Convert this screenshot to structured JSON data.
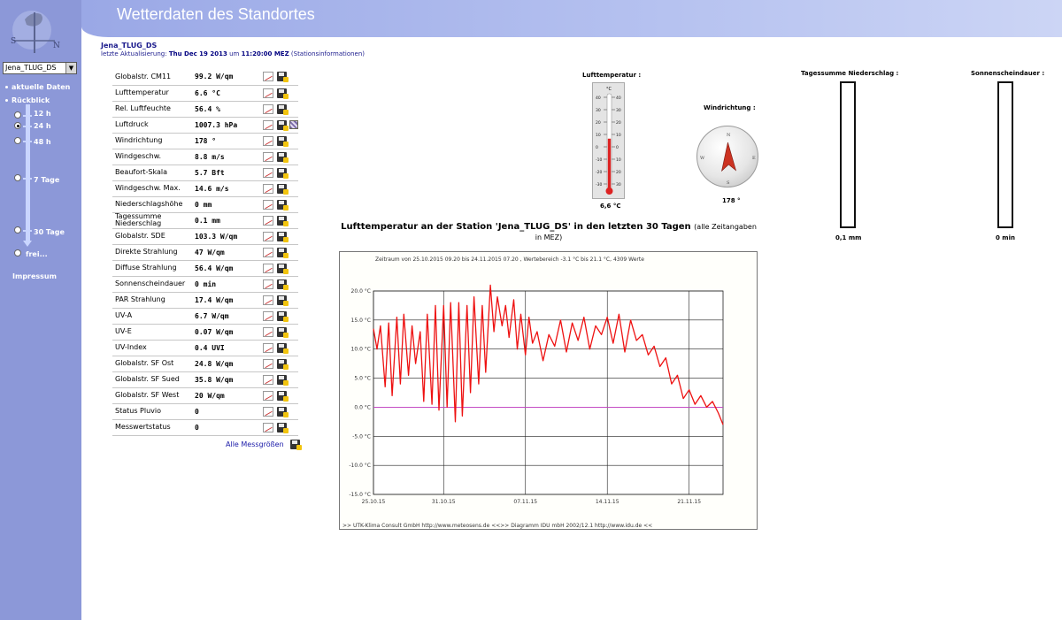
{
  "header": {
    "title": "Wetterdaten des Standortes"
  },
  "sidebar": {
    "station_select": "Jena_TLUG_DS",
    "links": {
      "current": "aktuelle Daten",
      "review": "Rückblick",
      "impressum": "Impressum"
    },
    "ranges": [
      {
        "label": "12 h",
        "checked": false
      },
      {
        "label": "24 h",
        "checked": true
      },
      {
        "label": "48 h",
        "checked": false
      },
      {
        "label": "7 Tage",
        "checked": false
      },
      {
        "label": "30 Tage",
        "checked": false
      },
      {
        "label": "frei...",
        "checked": false
      }
    ]
  },
  "station": {
    "name": "Jena_TLUG_DS",
    "update_prefix": "letzte Aktualisierung:",
    "update_date": "Thu Dec 19 2013",
    "update_um": "um",
    "update_time": "11:20:00 MEZ",
    "info_link": "(Stationsinformationen)"
  },
  "measurements": [
    {
      "label": "Globalstr. CM11",
      "value": "99.2 W/qm",
      "extra_icon": false
    },
    {
      "label": "Lufttemperatur",
      "value": "6.6 °C",
      "extra_icon": false
    },
    {
      "label": "Rel. Luftfeuchte",
      "value": "56.4 %",
      "extra_icon": false
    },
    {
      "label": "Luftdruck",
      "value": "1007.3 hPa",
      "extra_icon": true
    },
    {
      "label": "Windrichtung",
      "value": "178 °",
      "extra_icon": false
    },
    {
      "label": "Windgeschw.",
      "value": "8.8 m/s",
      "extra_icon": false
    },
    {
      "label": "Beaufort-Skala",
      "value": "5.7 Bft",
      "extra_icon": false
    },
    {
      "label": "Windgeschw. Max.",
      "value": "14.6 m/s",
      "extra_icon": false
    },
    {
      "label": "Niederschlagshöhe",
      "value": "0 mm",
      "extra_icon": false
    },
    {
      "label": "Tagessumme Niederschlag",
      "value": "0.1 mm",
      "extra_icon": false
    },
    {
      "label": "Globalstr. SDE",
      "value": "103.3 W/qm",
      "extra_icon": false
    },
    {
      "label": "Direkte Strahlung",
      "value": "47 W/qm",
      "extra_icon": false
    },
    {
      "label": "Diffuse Strahlung",
      "value": "56.4 W/qm",
      "extra_icon": false
    },
    {
      "label": "Sonnenscheindauer",
      "value": "0 min",
      "extra_icon": false
    },
    {
      "label": "PAR Strahlung",
      "value": "17.4 W/qm",
      "extra_icon": false
    },
    {
      "label": "UV-A",
      "value": "6.7 W/qm",
      "extra_icon": false
    },
    {
      "label": "UV-E",
      "value": "0.07 W/qm",
      "extra_icon": false
    },
    {
      "label": "UV-Index",
      "value": "0.4 UVI",
      "extra_icon": false
    },
    {
      "label": "Globalstr. SF Ost",
      "value": "24.8 W/qm",
      "extra_icon": false
    },
    {
      "label": "Globalstr. SF Sued",
      "value": "35.8 W/qm",
      "extra_icon": false
    },
    {
      "label": "Globalstr. SF West",
      "value": "20 W/qm",
      "extra_icon": false
    },
    {
      "label": "Status Pluvio",
      "value": "0",
      "extra_icon": false
    },
    {
      "label": "Messwertstatus",
      "value": "0",
      "extra_icon": false
    }
  ],
  "all_measures_link": "Alle Messgrößen",
  "gauges": {
    "temperature": {
      "caption": "Lufttemperatur :",
      "unit": "°C",
      "value_label": "6,6 °C",
      "value": 6.6,
      "scale": [
        40,
        30,
        20,
        10,
        0,
        -10,
        -20,
        -30
      ],
      "scale_right": [
        40,
        30,
        20,
        10,
        0,
        10,
        20,
        30
      ],
      "color": "#dd2222"
    },
    "wind": {
      "caption": "Windrichtung :",
      "value_label": "178 °",
      "direction_deg": 178,
      "arrow_color": "#cc3322"
    },
    "precipitation": {
      "caption": "Tagessumme Niederschlag :",
      "value_label": "0,1 mm",
      "fraction": 0.0
    },
    "sunshine": {
      "caption": "Sonnenscheindauer :",
      "value_label": "0 min",
      "fraction": 0.0
    }
  },
  "chart": {
    "title": "Lufttemperatur an der Station 'Jena_TLUG_DS' in den letzten 30 Tagen",
    "title_note": "(alle Zeitangaben in MEZ)",
    "header_text": "Zeitraum von 25.10.2015 09.20 bis 24.11.2015 07.20 , Wertebereich -3.1 °C bis 21.1 °C, 4309 Werte",
    "footer_text": ">> UTK-Klima Consult GmbH http://www.meteosens.de <<>> Diagramm IDU mbH 2002/12.1  http://www.idu.de <<"
  },
  "chart_data": {
    "type": "line",
    "title": "Lufttemperatur an der Station 'Jena_TLUG_DS' in den letzten 30 Tagen",
    "xlabel": "",
    "ylabel": "",
    "ylim": [
      -15,
      20
    ],
    "yticks": [
      "20.0 °C",
      "15.0 °C",
      "10.0 °C",
      "5.0 °C",
      "0.0 °C",
      "-5.0 °C",
      "-10.0 °C",
      "-15.0 °C"
    ],
    "yticks_values": [
      20,
      15,
      10,
      5,
      0,
      -5,
      -10,
      -15
    ],
    "xlim": [
      "2015-10-25 09:20",
      "2015-11-24 07:20"
    ],
    "xticks": [
      "25.10.15",
      "31.10.15",
      "07.11.15",
      "14.11.15",
      "21.11.15"
    ],
    "reference_line": {
      "y": 0,
      "color": "#cc44cc"
    },
    "grid": true,
    "series": [
      {
        "color": "#ee1111",
        "days": [
          0,
          0.3,
          0.6,
          1.0,
          1.3,
          1.6,
          2.0,
          2.3,
          2.6,
          3.0,
          3.3,
          3.6,
          4.0,
          4.3,
          4.6,
          5.0,
          5.3,
          5.6,
          6.0,
          6.3,
          6.6,
          7.0,
          7.3,
          7.6,
          8.0,
          8.3,
          8.6,
          9.0,
          9.3,
          9.6,
          10.0,
          10.3,
          10.6,
          11.0,
          11.3,
          11.6,
          12.0,
          12.3,
          12.6,
          13.0,
          13.3,
          13.6,
          14.0,
          14.5,
          15.0,
          15.5,
          16.0,
          16.5,
          17.0,
          17.5,
          18.0,
          18.5,
          19.0,
          19.5,
          20.0,
          20.5,
          21.0,
          21.5,
          22.0,
          22.5,
          23.0,
          23.5,
          24.0,
          24.5,
          25.0,
          25.5,
          26.0,
          26.5,
          27.0,
          27.5,
          28.0,
          28.5,
          29.0,
          29.5,
          29.9
        ],
        "values": [
          13.5,
          10.0,
          14.0,
          3.5,
          14.5,
          2.0,
          15.5,
          4.0,
          16.0,
          5.5,
          14.0,
          7.5,
          13.0,
          1.0,
          16.0,
          0.5,
          17.5,
          -0.5,
          17.5,
          0.0,
          18.0,
          -2.5,
          18.0,
          -1.5,
          17.5,
          2.5,
          19.0,
          4.0,
          17.5,
          6.0,
          21.0,
          13.0,
          19.0,
          14.0,
          17.5,
          12.0,
          18.5,
          10.0,
          16.0,
          9.0,
          15.5,
          11.0,
          13.0,
          8.0,
          12.5,
          10.5,
          15.0,
          9.5,
          14.5,
          11.5,
          15.5,
          10.0,
          14.0,
          12.5,
          15.5,
          11.0,
          16.0,
          9.5,
          15.0,
          11.5,
          12.5,
          9.0,
          10.5,
          7.0,
          8.5,
          4.0,
          5.5,
          1.5,
          3.0,
          0.5,
          2.0,
          0.0,
          1.0,
          -1.0,
          -3.0
        ]
      }
    ]
  }
}
